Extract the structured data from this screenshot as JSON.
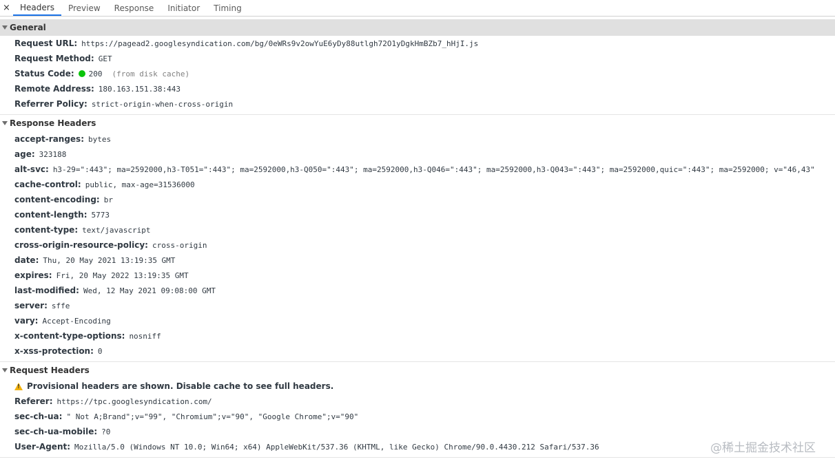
{
  "tabs": {
    "close": "×",
    "items": [
      "Headers",
      "Preview",
      "Response",
      "Initiator",
      "Timing"
    ]
  },
  "general": {
    "title": "General",
    "request_url_key": "Request URL:",
    "request_url": "https://pagead2.googlesyndication.com/bg/0eWRs9v2owYuE6yDy88utlgh72O1yDgkHmBZb7_hHjI.js",
    "request_method_key": "Request Method:",
    "request_method": "GET",
    "status_code_key": "Status Code:",
    "status_code": "200",
    "status_note": "(from disk cache)",
    "remote_address_key": "Remote Address:",
    "remote_address": "180.163.151.38:443",
    "referrer_policy_key": "Referrer Policy:",
    "referrer_policy": "strict-origin-when-cross-origin"
  },
  "response_headers": {
    "title": "Response Headers",
    "items": [
      {
        "key": "accept-ranges:",
        "value": "bytes"
      },
      {
        "key": "age:",
        "value": "323188"
      },
      {
        "key": "alt-svc:",
        "value": "h3-29=\":443\"; ma=2592000,h3-T051=\":443\"; ma=2592000,h3-Q050=\":443\"; ma=2592000,h3-Q046=\":443\"; ma=2592000,h3-Q043=\":443\"; ma=2592000,quic=\":443\"; ma=2592000; v=\"46,43\""
      },
      {
        "key": "cache-control:",
        "value": "public, max-age=31536000"
      },
      {
        "key": "content-encoding:",
        "value": "br"
      },
      {
        "key": "content-length:",
        "value": "5773"
      },
      {
        "key": "content-type:",
        "value": "text/javascript"
      },
      {
        "key": "cross-origin-resource-policy:",
        "value": "cross-origin"
      },
      {
        "key": "date:",
        "value": "Thu, 20 May 2021 13:19:35 GMT"
      },
      {
        "key": "expires:",
        "value": "Fri, 20 May 2022 13:19:35 GMT"
      },
      {
        "key": "last-modified:",
        "value": "Wed, 12 May 2021 09:08:00 GMT"
      },
      {
        "key": "server:",
        "value": "sffe"
      },
      {
        "key": "vary:",
        "value": "Accept-Encoding"
      },
      {
        "key": "x-content-type-options:",
        "value": "nosniff"
      },
      {
        "key": "x-xss-protection:",
        "value": "0"
      }
    ]
  },
  "request_headers": {
    "title": "Request Headers",
    "warning": "Provisional headers are shown. Disable cache to see full headers.",
    "items": [
      {
        "key": "Referer:",
        "value": "https://tpc.googlesyndication.com/"
      },
      {
        "key": "sec-ch-ua:",
        "value": "\" Not A;Brand\";v=\"99\", \"Chromium\";v=\"90\", \"Google Chrome\";v=\"90\""
      },
      {
        "key": "sec-ch-ua-mobile:",
        "value": "?0"
      },
      {
        "key": "User-Agent:",
        "value": "Mozilla/5.0 (Windows NT 10.0; Win64; x64) AppleWebKit/537.36 (KHTML, like Gecko) Chrome/90.0.4430.212 Safari/537.36"
      }
    ]
  },
  "watermark": "@稀土掘金技术社区",
  "colors": {
    "tab_active_underline": "#1a73e8",
    "status_ok": "#0ac40a",
    "warning": "#f2b10c",
    "general_header_bg": "#e0e0e0"
  }
}
